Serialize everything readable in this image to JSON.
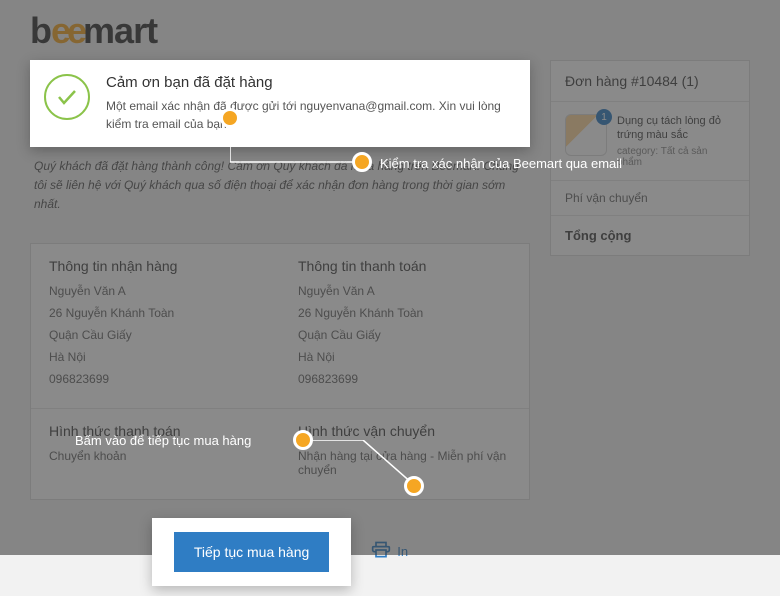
{
  "logo": {
    "pre": "b",
    "mid": "ee",
    "post": "mart"
  },
  "thanks": {
    "title": "Cảm ơn bạn đã đặt hàng",
    "sub": "Một email xác nhận đã được gửi tới nguyenvana@gmail.com. Xin vui lòng kiểm tra email của bạn"
  },
  "success_note": "Quý khách đã đặt hàng thành công! Cảm ơn Quý khách đã mua hàng trên Beemart. Chúng tôi sẽ liên hệ với Quý khách qua số điện thoại để xác nhận đơn hàng trong thời gian sớm nhất.",
  "delivery": {
    "heading": "Thông tin nhận hàng",
    "name": "Nguyễn Văn A",
    "street": "26 Nguyễn Khánh Toàn",
    "district": "Quận Cầu Giấy",
    "city": "Hà Nội",
    "phone": "096823699"
  },
  "billing": {
    "heading": "Thông tin thanh toán",
    "name": "Nguyễn Văn A",
    "street": "26 Nguyễn Khánh Toàn",
    "district": "Quận Cầu Giấy",
    "city": "Hà Nội",
    "phone": "096823699"
  },
  "payment": {
    "heading": "Hình thức thanh toán",
    "value": "Chuyển khoản"
  },
  "shipping": {
    "heading": "Hình thức vận chuyển",
    "value": "Nhận hàng tại cửa hàng - Miễn phí vận chuyển"
  },
  "continue_label": "Tiếp tục mua hàng",
  "print_label": "In",
  "order": {
    "header": "Đơn hàng #10484 (1)",
    "item_name": "Dụng cụ tách lòng đỏ trứng màu sắc",
    "item_category": "category: Tất cả sản phẩm",
    "shipping_fee": "Phí vận chuyển",
    "total": "Tổng cộng"
  },
  "callouts": {
    "email": "Kiểm tra xác nhận của Beemart qua email",
    "continue": "Bấm vào để tiếp tục mua hàng"
  }
}
